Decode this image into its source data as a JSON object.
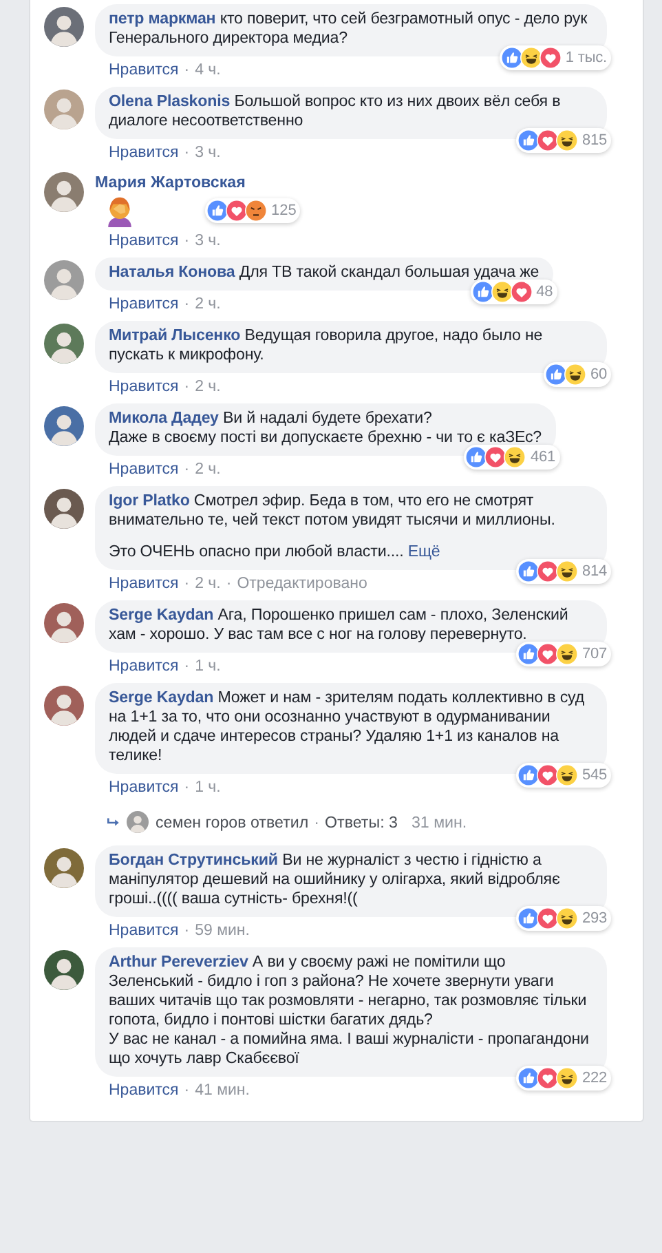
{
  "separator": "·",
  "comments": [
    {
      "author": "петр маркман",
      "paragraphs": [
        "кто поверит, что сей безграмотный опус - дело рук Генерального директора медиа?"
      ],
      "reactions": [
        {
          "kind": "like"
        },
        {
          "kind": "haha"
        },
        {
          "kind": "love"
        }
      ],
      "reaction_count": "1 тыс.",
      "like_label": "Нравится",
      "time": "4 ч."
    },
    {
      "author": "Olena Plaskonis",
      "paragraphs": [
        "Большой вопрос кто из них двоих вёл себя в диалоге несоответственно"
      ],
      "reactions": [
        {
          "kind": "like"
        },
        {
          "kind": "love"
        },
        {
          "kind": "haha"
        }
      ],
      "reaction_count": "815",
      "like_label": "Нравится",
      "time": "3 ч."
    },
    {
      "author": "Мария Жартовская",
      "kind": "sticker",
      "reactions": [
        {
          "kind": "like"
        },
        {
          "kind": "love"
        },
        {
          "kind": "angry"
        }
      ],
      "reaction_count": "125",
      "like_label": "Нравится",
      "time": "3 ч."
    },
    {
      "author": "Наталья Конова",
      "paragraphs": [
        "Для ТВ такой скандал большая удача же"
      ],
      "reactions": [
        {
          "kind": "like"
        },
        {
          "kind": "haha"
        },
        {
          "kind": "love"
        }
      ],
      "reaction_count": "48",
      "like_label": "Нравится",
      "time": "2 ч."
    },
    {
      "author": "Митрай Лысенко",
      "paragraphs": [
        "Ведущая говорила другое, надо было не пускать к микрофону."
      ],
      "reactions": [
        {
          "kind": "like"
        },
        {
          "kind": "haha"
        }
      ],
      "reaction_count": "60",
      "like_label": "Нравится",
      "time": "2 ч."
    },
    {
      "author": "Микола Дадеу",
      "paragraphs": [
        "Ви й надалі будете брехати?\nДаже в своєму пості ви допускаєте брехню - чи то є каЗЕс?"
      ],
      "reactions": [
        {
          "kind": "like"
        },
        {
          "kind": "love"
        },
        {
          "kind": "haha"
        }
      ],
      "reaction_count": "461",
      "like_label": "Нравится",
      "time": "2 ч."
    },
    {
      "author": "Igor Platko",
      "paragraphs": [
        "Смотрел эфир. Беда в том, что его не смотрят внимательно те, чей текст потом увидят тысячи и миллионы.",
        "Это ОЧЕНЬ опасно при любой власти...."
      ],
      "more": "Ещё",
      "reactions": [
        {
          "kind": "like"
        },
        {
          "kind": "love"
        },
        {
          "kind": "haha"
        }
      ],
      "reaction_count": "814",
      "like_label": "Нравится",
      "time": "2 ч.",
      "edited": "Отредактировано"
    },
    {
      "author": "Serge Kaydan",
      "paragraphs": [
        "Ага, Порошенко пришел сам - плохо, Зеленский хам - хорошо. У вас там все с ног на голову перевернуто."
      ],
      "reactions": [
        {
          "kind": "like"
        },
        {
          "kind": "love"
        },
        {
          "kind": "haha"
        }
      ],
      "reaction_count": "707",
      "like_label": "Нравится",
      "time": "1 ч."
    },
    {
      "author": "Serge Kaydan",
      "paragraphs": [
        "Может и нам - зрителям подать коллективно в суд на 1+1 за то, что они осознанно участвуют в одурманивании людей и сдаче интересов страны? Удаляю 1+1 из каналов на телике!"
      ],
      "reactions": [
        {
          "kind": "like"
        },
        {
          "kind": "love"
        },
        {
          "kind": "haha"
        }
      ],
      "reaction_count": "545",
      "like_label": "Нравится",
      "time": "1 ч.",
      "reply": {
        "text": "семен горов ответил",
        "count": "Ответы: 3",
        "time": "31 мин."
      }
    },
    {
      "author": "Богдан Струтинський",
      "paragraphs": [
        "Ви не журналіст з честю і гідністю а маніпулятор дешевий на ошийнику у олігарха, який відробляє гроші..(((( ваша сутність- брехня!(("
      ],
      "reactions": [
        {
          "kind": "like"
        },
        {
          "kind": "love"
        },
        {
          "kind": "haha"
        }
      ],
      "reaction_count": "293",
      "like_label": "Нравится",
      "time": "59 мин."
    },
    {
      "author": "Arthur Pereverziev",
      "paragraphs": [
        "А ви у своєму ражі не помітили що Зеленський - бидло і гоп з района? Не хочете звернути уваги ваших читачів що так розмовляти - негарно, так розмовляє тільки гопота, бидло і понтові шістки багатих дядь?\nУ вас не канал - а помийна яма. І ваші журналісти - пропагандони що хочуть лавр Скабєєвої"
      ],
      "reactions": [
        {
          "kind": "like"
        },
        {
          "kind": "love"
        },
        {
          "kind": "haha"
        }
      ],
      "reaction_count": "222",
      "like_label": "Нравится",
      "time": "41 мин."
    }
  ]
}
